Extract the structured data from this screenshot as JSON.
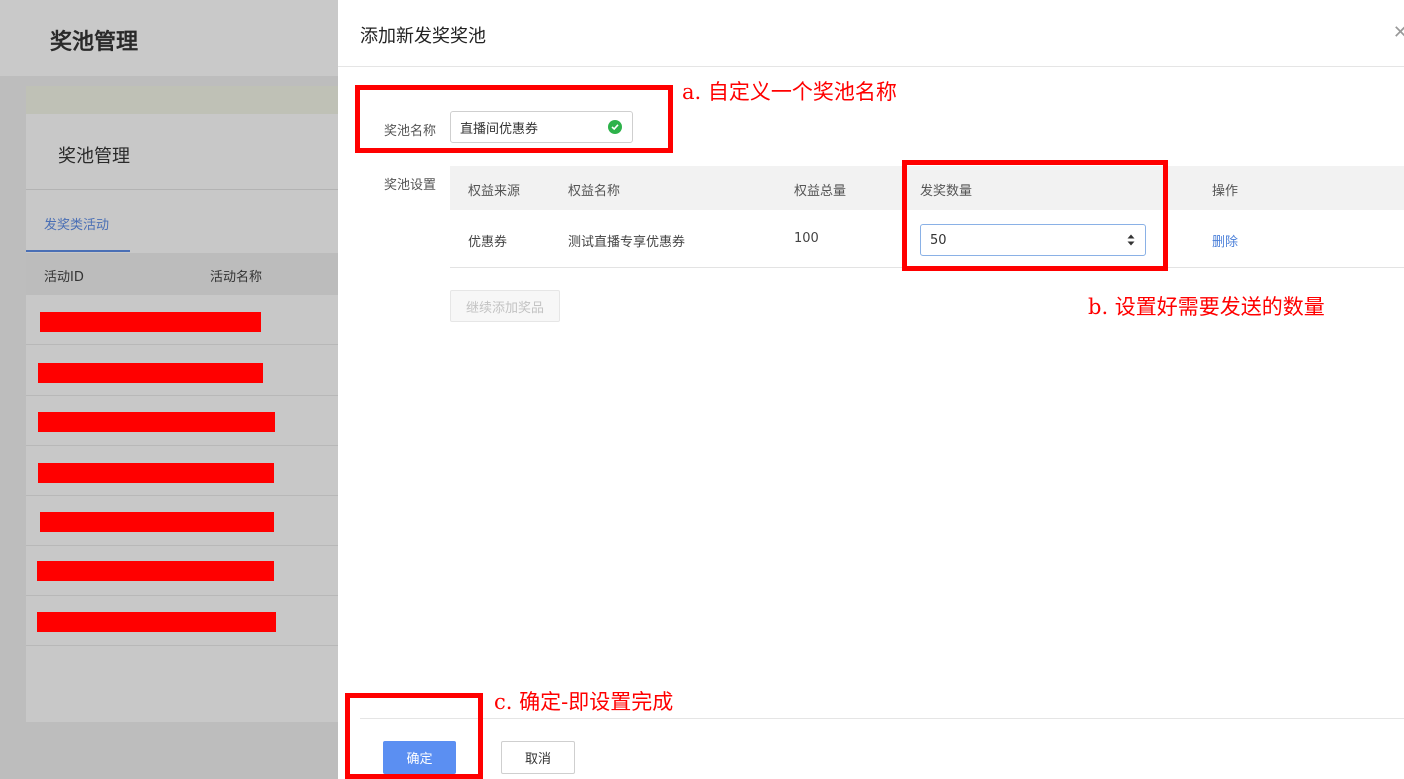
{
  "background": {
    "header_title": "奖池管理",
    "panel_title": "奖池管理",
    "tab_label": "发奖类活动",
    "columns": [
      "活动ID",
      "活动名称"
    ],
    "accent_color": "#4a6fb5"
  },
  "modal": {
    "title": "添加新发奖奖池",
    "close_icon": "close-icon",
    "pool_name_label": "奖池名称",
    "pool_name_value": "直播间优惠券",
    "pool_settings_label": "奖池设置",
    "table": {
      "headers": [
        "权益来源",
        "权益名称",
        "权益总量",
        "发奖数量",
        "操作"
      ],
      "rows": [
        {
          "source": "优惠券",
          "name": "测试直播专享优惠券",
          "total": "100",
          "quantity": "50",
          "action": "删除"
        }
      ]
    },
    "add_prize_label": "继续添加奖品",
    "ok_label": "确定",
    "cancel_label": "取消",
    "primary_color": "#5b8ff2"
  },
  "annotations": {
    "a": "a. 自定义一个奖池名称",
    "b": "b. 设置好需要发送的数量",
    "c": "c. 确定-即设置完成",
    "color": "#ff0000"
  }
}
